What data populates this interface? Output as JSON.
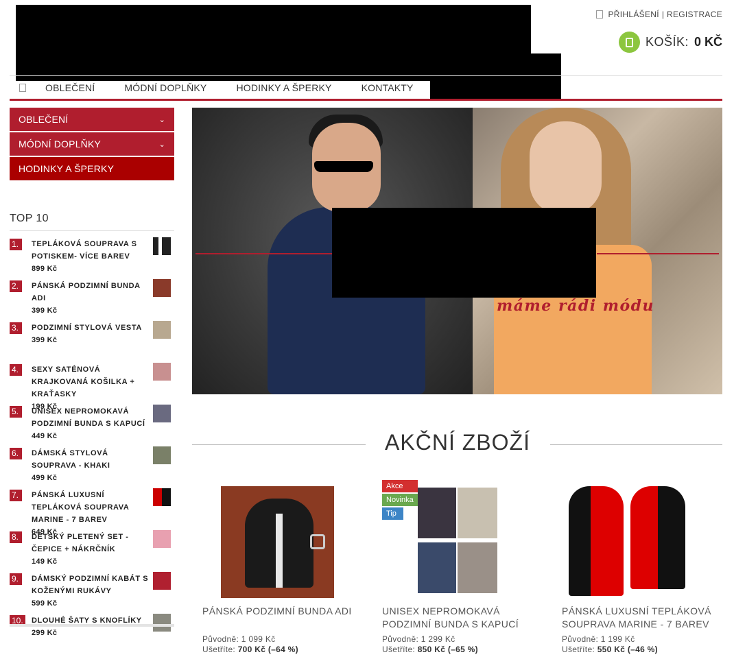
{
  "colors": {
    "accent": "#b01e2e",
    "accent_dark": "#a00000",
    "cart_green": "#8cc63f",
    "flag_akce": "#d32f2f",
    "flag_novinka": "#6aa84f",
    "flag_tip": "#3d85c6"
  },
  "header": {
    "login": "PŘIHLÁŠENÍ",
    "separator": "|",
    "register": "REGISTRACE",
    "cart_label": "KOŠÍK:",
    "cart_amount": "0 KČ"
  },
  "topnav": [
    "OBLEČENÍ",
    "MÓDNÍ DOPLŇKY",
    "HODINKY A ŠPERKY",
    "KONTAKTY"
  ],
  "categories": [
    "OBLEČENÍ",
    "MÓDNÍ DOPLŇKY",
    "HODINKY A ŠPERKY"
  ],
  "top10": {
    "title": "TOP 10",
    "items": [
      {
        "num": "1.",
        "name": "TEPLÁKOVÁ SOUPRAVA S POTISKEM- VÍCE BAREV",
        "price": "899 Kč"
      },
      {
        "num": "2.",
        "name": "PÁNSKÁ PODZIMNÍ BUNDA ADI",
        "price": "399 Kč"
      },
      {
        "num": "3.",
        "name": "PODZIMNÍ STYLOVÁ VESTA",
        "price": "399 Kč"
      },
      {
        "num": "4.",
        "name": "SEXY SATÉNOVÁ KRAJKOVANÁ KOŠILKA + KRAŤASKY",
        "price": "199 Kč"
      },
      {
        "num": "5.",
        "name": "UNISEX NEPROMOKAVÁ PODZIMNÍ BUNDA S KAPUCÍ",
        "price": "449 Kč"
      },
      {
        "num": "6.",
        "name": "DÁMSKÁ STYLOVÁ SOUPRAVA - KHAKI",
        "price": "499 Kč"
      },
      {
        "num": "7.",
        "name": "PÁNSKÁ LUXUSNÍ TEPLÁKOVÁ SOUPRAVA MARINE - 7 BAREV",
        "price": "649 Kč"
      },
      {
        "num": "8.",
        "name": "DĚTSKÝ PLETENÝ SET - ČEPICE + NÁKRČNÍK",
        "price": "149 Kč"
      },
      {
        "num": "9.",
        "name": "DÁMSKÝ PODZIMNÍ KABÁT S KOŽENÝMI RUKÁVY",
        "price": "599 Kč"
      },
      {
        "num": "10.",
        "name": "DLOUHÉ ŠATY S KNOFLÍKY",
        "price": "299 Kč"
      }
    ]
  },
  "banner": {
    "slogan": "máme rádi módu"
  },
  "section": {
    "title": "AKČNÍ ZBOŽÍ"
  },
  "products": [
    {
      "name": "PÁNSKÁ PODZIMNÍ BUNDA ADI",
      "orig_label": "Původně:",
      "orig": "1 099 Kč",
      "save_label": "Ušetříte:",
      "save": "700 Kč",
      "pct": "(–64 %)",
      "flags": []
    },
    {
      "name": "UNISEX NEPROMOKAVÁ PODZIMNÍ BUNDA S KAPUCÍ",
      "orig_label": "Původně:",
      "orig": "1 299 Kč",
      "save_label": "Ušetříte:",
      "save": "850 Kč",
      "pct": "(–65 %)",
      "flags": [
        "Akce",
        "Novinka",
        "Tip"
      ]
    },
    {
      "name": "PÁNSKÁ LUXUSNÍ TEPLÁKOVÁ SOUPRAVA MARINE - 7 BAREV",
      "orig_label": "Původně:",
      "orig": "1 199 Kč",
      "save_label": "Ušetříte:",
      "save": "550 Kč",
      "pct": "(–46 %)",
      "flags": []
    }
  ]
}
